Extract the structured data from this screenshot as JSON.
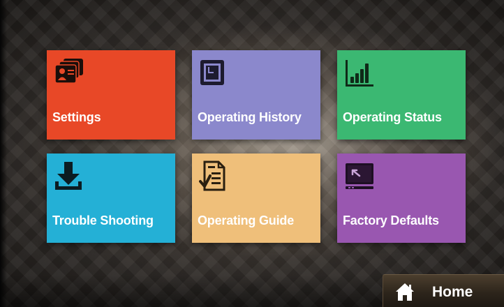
{
  "menu": {
    "tiles": [
      {
        "label": "Settings",
        "icon": "id-card-icon",
        "color": "#e84827"
      },
      {
        "label": "Operating History",
        "icon": "history-panel-icon",
        "color": "#8b88cc"
      },
      {
        "label": "Operating Status",
        "icon": "bar-signal-icon",
        "color": "#3bb872"
      },
      {
        "label": "Trouble Shooting",
        "icon": "download-arrow-icon",
        "color": "#24b0d6"
      },
      {
        "label": "Operating Guide",
        "icon": "checklist-document-icon",
        "color": "#efbf7a"
      },
      {
        "label": "Factory Defaults",
        "icon": "monitor-reset-icon",
        "color": "#9957b0"
      }
    ]
  },
  "footer": {
    "home_label": "Home",
    "home_icon": "house-icon"
  }
}
